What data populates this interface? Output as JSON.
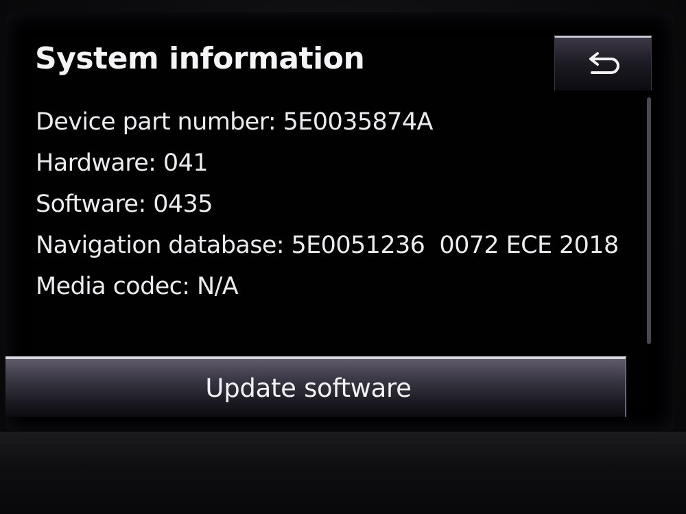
{
  "screen": {
    "title": "System information",
    "back_icon": "return-arrow-icon"
  },
  "info": {
    "rows": [
      "Device part number: 5E0035874A",
      "Hardware: 041",
      "Software: 0435",
      "Navigation database: 5E0051236  0072 ECE 2018",
      "Media codec: N/A"
    ]
  },
  "actions": {
    "update_label": "Update software"
  },
  "colors": {
    "background": "#010102",
    "text": "#ececf0",
    "button_highlight": "#d8d6df"
  }
}
